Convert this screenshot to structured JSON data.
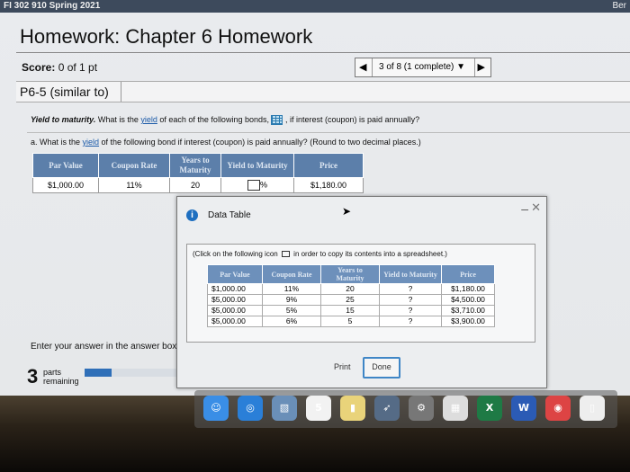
{
  "course_bar": {
    "title": "FI 302 910 Spring 2021",
    "right_text": "Ber"
  },
  "homework_title": "Homework: Chapter 6 Homework",
  "score": {
    "label": "Score:",
    "value": "0 of 1 pt"
  },
  "nav": {
    "prev": "◀",
    "text": "3 of 8 (1 complete)",
    "caret": "▼",
    "next": "▶"
  },
  "problem_title": "P6-5 (similar to)",
  "question": {
    "lead": "Yield to maturity.",
    "text_before": " What is the ",
    "link": "yield",
    "text_after": " of each of the following bonds, ",
    "text_end": " , if interest (coupon) is paid annually?"
  },
  "part_a": {
    "before": "a. What is the ",
    "link": "yield",
    "after": " of the following bond if interest (coupon) is paid annually? (Round to two decimal places.)"
  },
  "main_table": {
    "headers": [
      "Par Value",
      "Coupon Rate",
      "Years to Maturity",
      "Yield to Maturity",
      "Price"
    ],
    "row": {
      "par": "$1,000.00",
      "coupon": "11%",
      "years": "20",
      "ytm_unit": "%",
      "price": "$1,180.00"
    }
  },
  "modal": {
    "title": "Data Table",
    "note_before": "(Click on the following icon ",
    "note_after": " in order to copy its contents into a spreadsheet.)",
    "headers": [
      "Par Value",
      "Coupon Rate",
      "Years to Maturity",
      "Yield to Maturity",
      "Price"
    ],
    "rows": [
      {
        "par": "$1,000.00",
        "coupon": "11%",
        "years": "20",
        "ytm": "?",
        "price": "$1,180.00"
      },
      {
        "par": "$5,000.00",
        "coupon": "9%",
        "years": "25",
        "ytm": "?",
        "price": "$4,500.00"
      },
      {
        "par": "$5,000.00",
        "coupon": "5%",
        "years": "15",
        "ytm": "?",
        "price": "$3,710.00"
      },
      {
        "par": "$5,000.00",
        "coupon": "6%",
        "years": "5",
        "ytm": "?",
        "price": "$3,900.00"
      }
    ],
    "print_label": "Print",
    "done_label": "Done"
  },
  "answer_prompt": "Enter your answer in the answer box",
  "parts": {
    "count": "3",
    "label": "parts remaining",
    "progress_fraction": 0.25
  },
  "dock": [
    {
      "name": "finder-icon",
      "glyph": "☺",
      "color": "#3a8ee6"
    },
    {
      "name": "safari-icon",
      "glyph": "◎",
      "color": "#2a7fd8"
    },
    {
      "name": "preview-icon",
      "glyph": "▧",
      "color": "#6a8fb8"
    },
    {
      "name": "calendar-icon",
      "glyph": "5",
      "color": "#f2f2f2"
    },
    {
      "name": "notes-icon",
      "glyph": "▮",
      "color": "#e9d37a"
    },
    {
      "name": "launchpad-icon",
      "glyph": "➶",
      "color": "#556b86"
    },
    {
      "name": "settings-icon",
      "glyph": "⚙",
      "color": "#777"
    },
    {
      "name": "calendar-grid-icon",
      "glyph": "▦",
      "color": "#ddd"
    },
    {
      "name": "excel-icon",
      "glyph": "X",
      "color": "#1e7a45"
    },
    {
      "name": "word-icon",
      "glyph": "W",
      "color": "#2b5bb5"
    },
    {
      "name": "chrome-icon",
      "glyph": "◉",
      "color": "#d44"
    },
    {
      "name": "files-icon",
      "glyph": "▯",
      "color": "#eee"
    }
  ]
}
